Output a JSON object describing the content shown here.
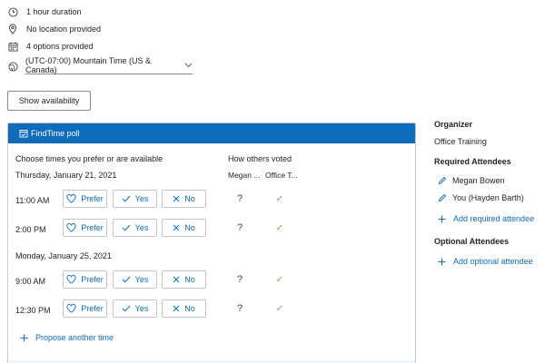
{
  "meeting_info": {
    "duration": "1 hour duration",
    "location": "No location provided",
    "options": "4 options provided",
    "timezone": "(UTC-07:00) Mountain Time (US & Canada)"
  },
  "icons": {
    "duration": "clock-icon",
    "location": "location-pin-icon",
    "options": "calendar-icon",
    "timezone": "globe-icon",
    "timezone_dropdown": "chevron-down-icon"
  },
  "show_availability_label": "Show availability",
  "poll": {
    "header": "FindTime poll",
    "choose_label": "Choose times you prefer or are available",
    "others_label": "How others voted",
    "voters": [
      "Megan ...",
      "Office T..."
    ],
    "vote_labels": {
      "prefer": "Prefer",
      "yes": "Yes",
      "no": "No"
    },
    "days": [
      {
        "date": "Thursday, January 21, 2021",
        "slots": [
          {
            "time": "11:00 AM",
            "votes": [
              "?",
              "✓"
            ]
          },
          {
            "time": "2:00 PM",
            "votes": [
              "?",
              "✓"
            ]
          }
        ]
      },
      {
        "date": "Monday, January 25, 2021",
        "slots": [
          {
            "time": "9:00 AM",
            "votes": [
              "?",
              "✓"
            ]
          },
          {
            "time": "12:30 PM",
            "votes": [
              "?",
              "✓"
            ]
          }
        ]
      }
    ],
    "propose_label": "Propose another time"
  },
  "sidebar": {
    "organizer_heading": "Organizer",
    "organizer": "Office Training",
    "required_heading": "Required Attendees",
    "required": [
      "Megan Bowen",
      "You (Hayden Barth)"
    ],
    "add_required_label": "Add required attendee",
    "optional_heading": "Optional Attendees",
    "add_optional_label": "Add optional attendee"
  },
  "colors": {
    "accent": "#0f6cbd",
    "check": "#7aa35a"
  }
}
